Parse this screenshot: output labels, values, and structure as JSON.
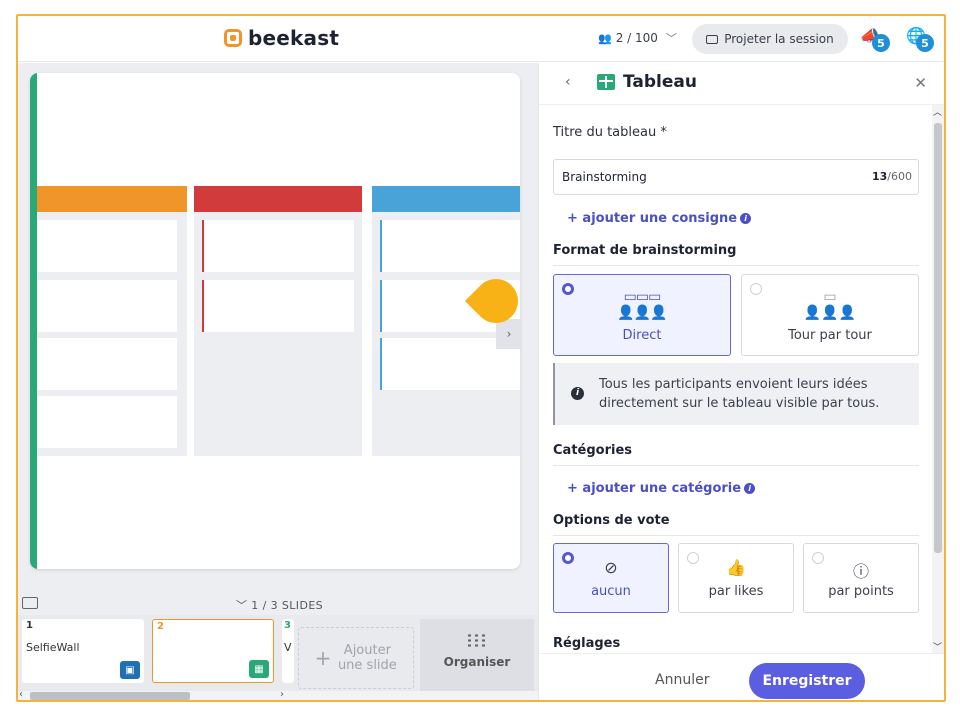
{
  "app": {
    "logo_text": "beekast"
  },
  "topbar": {
    "participants": "2 / 100",
    "project_label": "Projeter la session",
    "notifications_badge": "5",
    "language_badge": "5"
  },
  "slides_strip": {
    "label": "1 / 3 SLIDES",
    "slides": [
      {
        "num": "1",
        "title": "SelfieWall"
      },
      {
        "num": "2",
        "title": ""
      },
      {
        "num": "3",
        "title": "V"
      }
    ],
    "add_label": "Ajouter une slide",
    "organise_label": "Organiser"
  },
  "panel": {
    "title": "Tableau",
    "title_field_label": "Titre du tableau *",
    "title_value": "Brainstorming",
    "title_count": "13",
    "title_max": "/600",
    "add_instruction": "+ ajouter une consigne",
    "format_title": "Format de brainstorming",
    "formats": [
      {
        "label": "Direct",
        "selected": true
      },
      {
        "label": "Tour par tour",
        "selected": false
      }
    ],
    "format_info": "Tous les participants envoient leurs idées directement sur le tableau visible par tous.",
    "categories_title": "Catégories",
    "add_category": "+ ajouter une catégorie",
    "vote_title": "Options de vote",
    "vote_options": [
      {
        "label": "aucun",
        "selected": true
      },
      {
        "label": "par likes",
        "selected": false
      },
      {
        "label": "par points",
        "selected": false
      }
    ],
    "settings_title": "Réglages",
    "cancel_label": "Annuler",
    "save_label": "Enregistrer"
  },
  "colors": {
    "accent": "#5b5ee0",
    "frame": "#f6b33c",
    "col_orange": "#f0952a",
    "col_red": "#d13b3b",
    "col_blue": "#4aa3d8",
    "slide_accent": "#2aa878",
    "tooltip": "#f8b215"
  }
}
